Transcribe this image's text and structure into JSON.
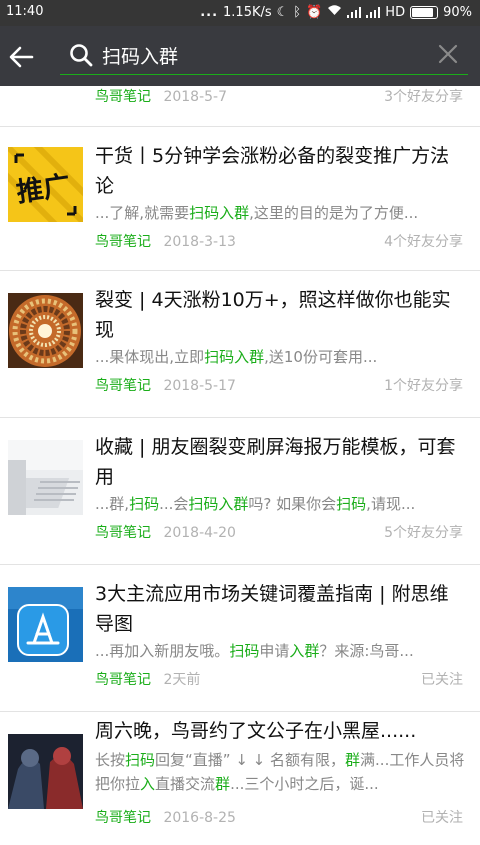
{
  "status_bar": {
    "time": "11:40",
    "dots": "...",
    "speed": "1.15K/s",
    "network": "HD",
    "battery": "90%"
  },
  "search": {
    "query": "扫码入群"
  },
  "partial_item": {
    "account": "鸟哥笔记",
    "date": "2018-5-7",
    "stat": "3个好友分享"
  },
  "results": [
    {
      "title": "干货丨5分钟学会涨粉必备的裂变推广方法论",
      "thumb_text": "推广",
      "snippet": [
        {
          "t": "...了解,就需要",
          "h": false
        },
        {
          "t": "扫码入群",
          "h": true
        },
        {
          "t": ",这里的目的是为了方便...",
          "h": false
        }
      ],
      "account": "鸟哥笔记",
      "date": "2018-3-13",
      "stat": "4个好友分享"
    },
    {
      "title": "裂变 | 4天涨粉10万+，照这样做你也能实现",
      "snippet": [
        {
          "t": "...果体现出,立即",
          "h": false
        },
        {
          "t": "扫码入群",
          "h": true
        },
        {
          "t": ",送10份可套用...",
          "h": false
        }
      ],
      "account": "鸟哥笔记",
      "date": "2018-5-17",
      "stat": "1个好友分享"
    },
    {
      "title": "收藏 | 朋友圈裂变刷屏海报万能模板，可套用",
      "snippet": [
        {
          "t": "...群,",
          "h": false
        },
        {
          "t": "扫码",
          "h": true
        },
        {
          "t": "...会",
          "h": false
        },
        {
          "t": "扫码入群",
          "h": true
        },
        {
          "t": "吗? 如果你会",
          "h": false
        },
        {
          "t": "扫码",
          "h": true
        },
        {
          "t": ",请现...",
          "h": false
        }
      ],
      "account": "鸟哥笔记",
      "date": "2018-4-20",
      "stat": "5个好友分享"
    },
    {
      "title": "3大主流应用市场关键词覆盖指南 | 附思维导图",
      "snippet": [
        {
          "t": "...再加入新朋友哦。",
          "h": false
        },
        {
          "t": "扫码",
          "h": true
        },
        {
          "t": "申请",
          "h": false
        },
        {
          "t": "入群",
          "h": true
        },
        {
          "t": "？来源:鸟哥...",
          "h": false
        }
      ],
      "account": "鸟哥笔记",
      "date": "2天前",
      "stat": "已关注"
    },
    {
      "title": "周六晚，鸟哥约了文公子在小黑屋......",
      "snippet": [
        {
          "t": "长按",
          "h": false
        },
        {
          "t": "扫码",
          "h": true
        },
        {
          "t": "回复“直播” ↓ ↓ 名额有限，",
          "h": false
        },
        {
          "t": "群",
          "h": true
        },
        {
          "t": "满...工作人员将把你拉",
          "h": false
        },
        {
          "t": "入",
          "h": true
        },
        {
          "t": "直播交流",
          "h": false
        },
        {
          "t": "群",
          "h": true
        },
        {
          "t": "...三个小时之后，诞...",
          "h": false
        }
      ],
      "account": "鸟哥笔记",
      "date": "2016-8-25",
      "stat": "已关注"
    }
  ],
  "colors": {
    "accent": "#1aad19",
    "topbar": "#393a3f",
    "statusbar": "#363636"
  }
}
